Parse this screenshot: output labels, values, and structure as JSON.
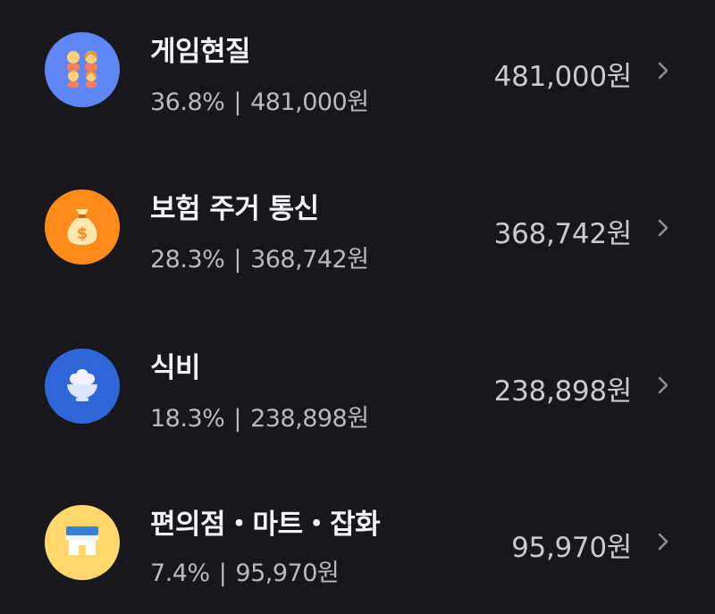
{
  "categories": [
    {
      "name": "게임현질",
      "percent": "36.8%",
      "separator": "|",
      "sub_amount": "481,000원",
      "amount": "481,000원",
      "icon": "family-icon",
      "color": "#5f86f5"
    },
    {
      "name": "보험 주거 통신",
      "percent": "28.3%",
      "separator": "|",
      "sub_amount": "368,742원",
      "amount": "368,742원",
      "icon": "money-bag-icon",
      "color": "#ff8c1a"
    },
    {
      "name": "식비",
      "percent": "18.3%",
      "separator": "|",
      "sub_amount": "238,898원",
      "amount": "238,898원",
      "icon": "rice-bowl-icon",
      "color": "#2f67d9"
    },
    {
      "name": "편의점・마트・잡화",
      "percent": "7.4%",
      "separator": "|",
      "sub_amount": "95,970원",
      "amount": "95,970원",
      "icon": "store-icon",
      "color": "#ffd76a"
    }
  ]
}
